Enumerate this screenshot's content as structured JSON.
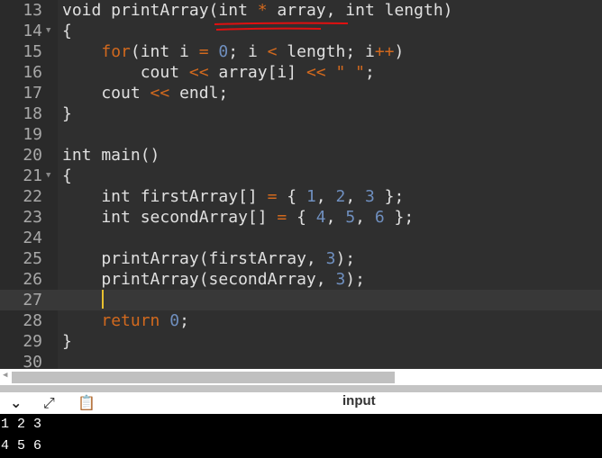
{
  "editor": {
    "lines": [
      {
        "n": "13",
        "tokens": [
          [
            "kw",
            "void printArray(int "
          ],
          [
            "op",
            "*"
          ],
          [
            "kw",
            " array, int length)"
          ]
        ]
      },
      {
        "n": "14",
        "fold": true,
        "tokens": [
          [
            "kw",
            "{"
          ]
        ]
      },
      {
        "n": "15",
        "tokens": [
          [
            "kw",
            "    "
          ],
          [
            "ctl",
            "for"
          ],
          [
            "kw",
            "(int i "
          ],
          [
            "op",
            "="
          ],
          [
            "kw",
            " "
          ],
          [
            "num",
            "0"
          ],
          [
            "kw",
            "; i "
          ],
          [
            "op",
            "<"
          ],
          [
            "kw",
            " length; i"
          ],
          [
            "op",
            "++"
          ],
          [
            "kw",
            ")"
          ]
        ]
      },
      {
        "n": "16",
        "tokens": [
          [
            "kw",
            "        cout "
          ],
          [
            "op",
            "<<"
          ],
          [
            "kw",
            " array[i] "
          ],
          [
            "op",
            "<<"
          ],
          [
            "kw",
            " "
          ],
          [
            "str",
            "\" \""
          ],
          [
            "kw",
            ";"
          ]
        ]
      },
      {
        "n": "17",
        "tokens": [
          [
            "kw",
            "    cout "
          ],
          [
            "op",
            "<<"
          ],
          [
            "kw",
            " endl;"
          ]
        ]
      },
      {
        "n": "18",
        "tokens": [
          [
            "kw",
            "}"
          ]
        ]
      },
      {
        "n": "19",
        "tokens": []
      },
      {
        "n": "20",
        "tokens": [
          [
            "kw",
            "int main()"
          ]
        ]
      },
      {
        "n": "21",
        "fold": true,
        "tokens": [
          [
            "kw",
            "{"
          ]
        ]
      },
      {
        "n": "22",
        "tokens": [
          [
            "kw",
            "    int firstArray[] "
          ],
          [
            "op",
            "="
          ],
          [
            "kw",
            " { "
          ],
          [
            "num",
            "1"
          ],
          [
            "kw",
            ", "
          ],
          [
            "num",
            "2"
          ],
          [
            "kw",
            ", "
          ],
          [
            "num",
            "3"
          ],
          [
            "kw",
            " };"
          ]
        ]
      },
      {
        "n": "23",
        "tokens": [
          [
            "kw",
            "    int secondArray[] "
          ],
          [
            "op",
            "="
          ],
          [
            "kw",
            " { "
          ],
          [
            "num",
            "4"
          ],
          [
            "kw",
            ", "
          ],
          [
            "num",
            "5"
          ],
          [
            "kw",
            ", "
          ],
          [
            "num",
            "6"
          ],
          [
            "kw",
            " };"
          ]
        ]
      },
      {
        "n": "24",
        "tokens": []
      },
      {
        "n": "25",
        "tokens": [
          [
            "kw",
            "    printArray(firstArray, "
          ],
          [
            "num",
            "3"
          ],
          [
            "kw",
            ");"
          ]
        ]
      },
      {
        "n": "26",
        "tokens": [
          [
            "kw",
            "    printArray(secondArray, "
          ],
          [
            "num",
            "3"
          ],
          [
            "kw",
            ");"
          ]
        ]
      },
      {
        "n": "27",
        "active": true,
        "tokens": []
      },
      {
        "n": "28",
        "tokens": [
          [
            "kw",
            "    "
          ],
          [
            "ctl",
            "return"
          ],
          [
            "kw",
            " "
          ],
          [
            "num",
            "0"
          ],
          [
            "kw",
            ";"
          ]
        ]
      },
      {
        "n": "29",
        "tokens": [
          [
            "kw",
            "}"
          ]
        ]
      },
      {
        "n": "30",
        "tokens": []
      }
    ]
  },
  "panel": {
    "label": "input"
  },
  "console": {
    "lines": [
      "1 2 3",
      "4 5 6"
    ]
  }
}
